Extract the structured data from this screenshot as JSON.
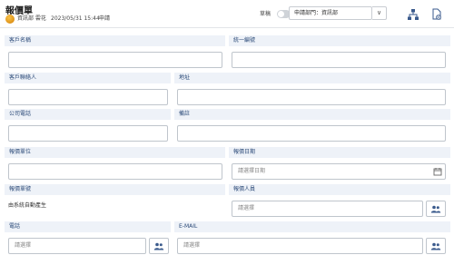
{
  "header": {
    "title": "報價單",
    "author": "資訊部 雲花",
    "datetime": "2023/05/31 15:44",
    "status": "申請",
    "draft_label": "草稿",
    "dept_select_value": "申請部門：資訊部",
    "select_caret": "∨"
  },
  "form": {
    "customer_name": {
      "label": "客戶名稱",
      "value": ""
    },
    "tax_id": {
      "label": "統一編號",
      "value": ""
    },
    "contact": {
      "label": "客戶聯絡人",
      "value": ""
    },
    "address": {
      "label": "地址",
      "value": ""
    },
    "company_phone": {
      "label": "公司電話",
      "value": ""
    },
    "remarks": {
      "label": "備註",
      "value": ""
    },
    "quote_unit": {
      "label": "報價單位",
      "value": ""
    },
    "quote_date": {
      "label": "報價日期",
      "placeholder": "請選擇日期"
    },
    "quote_no": {
      "label": "報價單號",
      "value": "由系統自動產生"
    },
    "quoter": {
      "label": "報價人員",
      "placeholder": "請選擇"
    },
    "phone": {
      "label": "電話",
      "placeholder": "請選擇"
    },
    "email": {
      "label": "E-MAIL",
      "placeholder": "請選擇"
    }
  },
  "icons": {
    "org_chart": "org-chart-icon",
    "document_settings": "document-settings-icon",
    "calendar": "calendar-icon",
    "people": "people-icon"
  },
  "colors": {
    "label_bg": "#eef2f8",
    "label_text": "#2b4a78",
    "icon_blue": "#3a5a8c",
    "toggle_off": "#cfd3d8"
  }
}
